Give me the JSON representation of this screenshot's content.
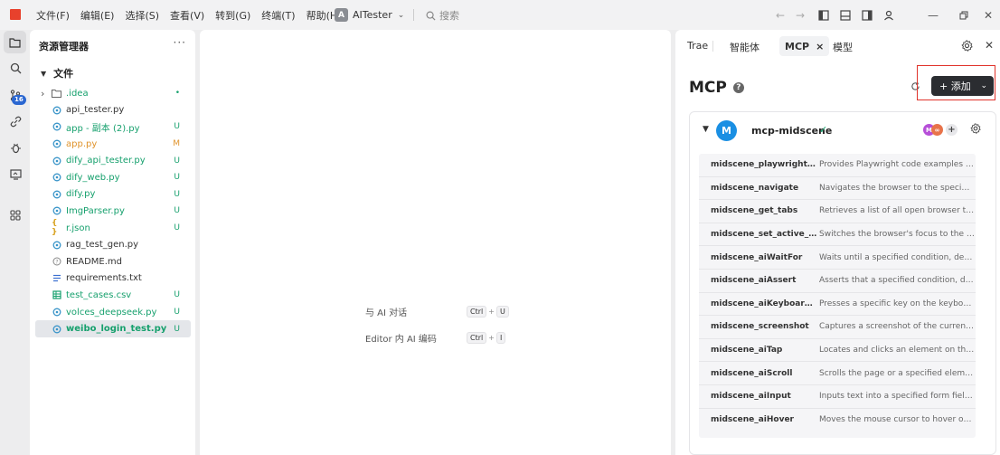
{
  "titlebar": {
    "menu": [
      "文件(F)",
      "编辑(E)",
      "选择(S)",
      "查看(V)",
      "转到(G)",
      "终端(T)",
      "帮助(H)"
    ],
    "workspace_badge": "A",
    "workspace_name": "AITester",
    "search_placeholder": "搜索"
  },
  "activity": {
    "badge": "16",
    "icons": [
      "explorer-icon",
      "search-icon",
      "source-control-icon",
      "extensions-icon",
      "debug-icon",
      "remote-icon",
      "apps-icon"
    ]
  },
  "explorer": {
    "title": "资源管理器",
    "more": "···",
    "folder": "文件",
    "files": [
      {
        "name": ".idea",
        "type": "folder",
        "status": "•",
        "color": "green"
      },
      {
        "name": "api_tester.py",
        "type": "py",
        "status": "",
        "color": "default"
      },
      {
        "name": "app - 副本 (2).py",
        "type": "py",
        "status": "U",
        "color": "green"
      },
      {
        "name": "app.py",
        "type": "py",
        "status": "M",
        "color": "orange"
      },
      {
        "name": "dify_api_tester.py",
        "type": "py",
        "status": "U",
        "color": "green"
      },
      {
        "name": "dify_web.py",
        "type": "py",
        "status": "U",
        "color": "green"
      },
      {
        "name": "dify.py",
        "type": "py",
        "status": "U",
        "color": "green"
      },
      {
        "name": "ImgParser.py",
        "type": "py",
        "status": "U",
        "color": "green"
      },
      {
        "name": "r.json",
        "type": "json",
        "status": "U",
        "color": "green"
      },
      {
        "name": "rag_test_gen.py",
        "type": "py",
        "status": "",
        "color": "default"
      },
      {
        "name": "README.md",
        "type": "md",
        "status": "",
        "color": "default"
      },
      {
        "name": "requirements.txt",
        "type": "txt",
        "status": "",
        "color": "default"
      },
      {
        "name": "test_cases.csv",
        "type": "csv",
        "status": "U",
        "color": "green"
      },
      {
        "name": "volces_deepseek.py",
        "type": "py",
        "status": "U",
        "color": "green"
      },
      {
        "name": "weibo_login_test.py",
        "type": "py",
        "status": "U",
        "color": "green",
        "selected": true
      }
    ]
  },
  "editor": {
    "shortcuts": [
      {
        "label": "与 AI 对话",
        "keys": [
          "Ctrl",
          "U"
        ]
      },
      {
        "label": "Editor 内 AI 编码",
        "keys": [
          "Ctrl",
          "I"
        ]
      }
    ]
  },
  "panel": {
    "tabs": [
      {
        "label": "Trae",
        "active": false
      },
      {
        "label": "智能体",
        "active": false
      },
      {
        "label": "MCP",
        "active": true,
        "close": "×"
      },
      {
        "label": "模型",
        "active": false
      }
    ],
    "title": "MCP",
    "help": "?",
    "add_label": "+ 添加",
    "server": {
      "avatar": "M",
      "name": "mcp-midscene",
      "check": "✓",
      "tools": [
        {
          "name": "midscene_playwright_exa...",
          "desc": "Provides Playwright code examples for ..."
        },
        {
          "name": "midscene_navigate",
          "desc": "Navigates the browser to the specified U..."
        },
        {
          "name": "midscene_get_tabs",
          "desc": "Retrieves a list of all open browser tabs, i..."
        },
        {
          "name": "midscene_set_active_tab",
          "desc": "Switches the browser's focus to the tab s..."
        },
        {
          "name": "midscene_aiWaitFor",
          "desc": "Waits until a specified condition, describ..."
        },
        {
          "name": "midscene_aiAssert",
          "desc": "Asserts that a specified condition, descri..."
        },
        {
          "name": "midscene_aiKeyboardPress",
          "desc": "Presses a specific key on the keyboard."
        },
        {
          "name": "midscene_screenshot",
          "desc": "Captures a screenshot of the currently a..."
        },
        {
          "name": "midscene_aiTap",
          "desc": "Locates and clicks an element on the cur..."
        },
        {
          "name": "midscene_aiScroll",
          "desc": "Scrolls the page or a specified element. ..."
        },
        {
          "name": "midscene_aiInput",
          "desc": "Inputs text into a specified form field or ..."
        },
        {
          "name": "midscene_aiHover",
          "desc": "Moves the mouse cursor to hover over a..."
        }
      ]
    }
  },
  "colors": {
    "accent": "#2b67d1",
    "green": "#16a06d",
    "orange": "#e0932b",
    "highlight": "#e0332b"
  }
}
